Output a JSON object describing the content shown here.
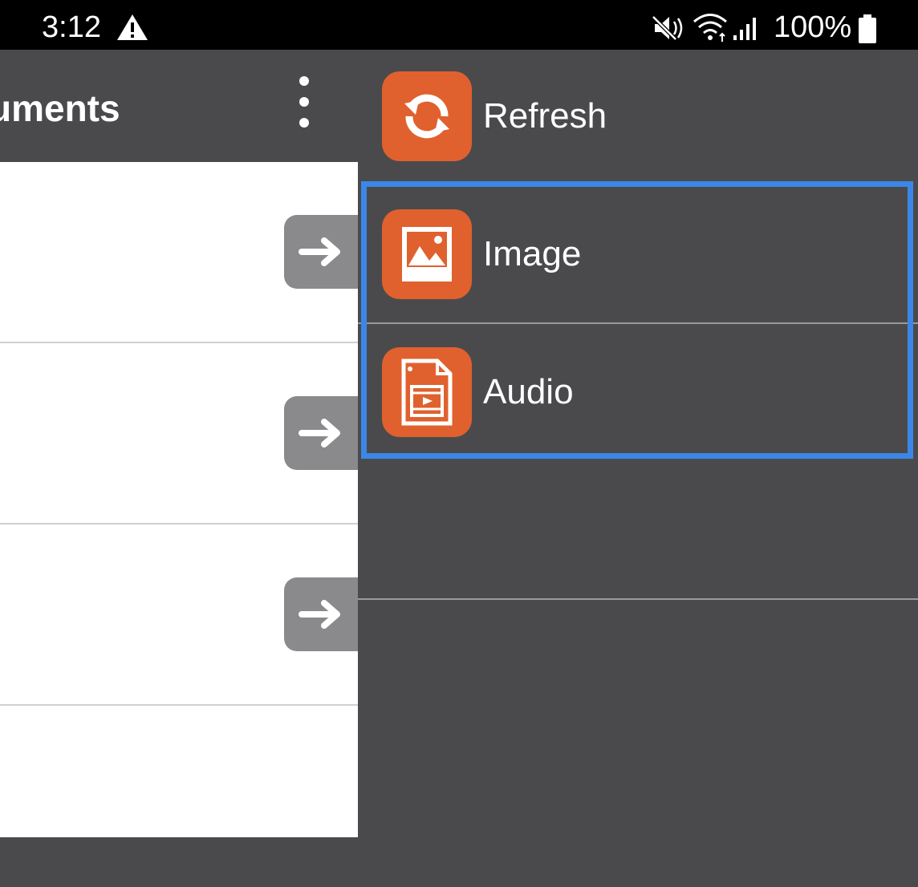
{
  "status_bar": {
    "time": "3:12",
    "battery": "100%",
    "icons": [
      "warning-icon",
      "mute-icon",
      "wifi-icon",
      "signal-icon",
      "battery-icon"
    ]
  },
  "app_bar": {
    "title": "uments",
    "overflow_icon": "more-vert-icon"
  },
  "documents": {
    "rows": [
      {
        "action_icon": "arrow-right-icon"
      },
      {
        "action_icon": "arrow-right-icon"
      },
      {
        "action_icon": "arrow-right-icon"
      }
    ]
  },
  "menu": {
    "items": [
      {
        "label": "Refresh",
        "icon": "refresh-icon"
      },
      {
        "label": "Image",
        "icon": "image-icon"
      },
      {
        "label": "Audio",
        "icon": "media-file-icon"
      }
    ]
  },
  "colors": {
    "accent": "#e0612e",
    "highlight": "#3c86e8",
    "panel": "#4a4a4c",
    "status_bar": "#000000"
  }
}
